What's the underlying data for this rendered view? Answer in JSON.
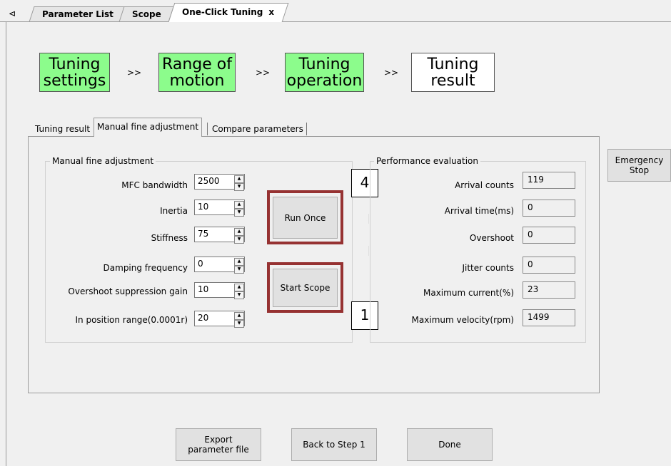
{
  "doc_tabs": {
    "scroll_icon": "⊲",
    "items": [
      "Parameter List",
      "Scope",
      "One-Click Tuning"
    ],
    "close_icon": "x"
  },
  "steps": [
    {
      "label": "Tuning settings",
      "state": "done"
    },
    {
      "label": "Range of motion",
      "state": "done"
    },
    {
      "label": "Tuning operation",
      "state": "done"
    },
    {
      "label": "Tuning result",
      "state": "todo"
    }
  ],
  "step_arrow": ">>",
  "inner_tabs": [
    "Tuning result",
    "Manual fine adjustment",
    "Compare parameters"
  ],
  "manual": {
    "title": "Manual fine adjustment",
    "fields": [
      {
        "label": "MFC bandwidth",
        "value": "2500"
      },
      {
        "label": "Inertia",
        "value": "10"
      },
      {
        "label": "Stiffness",
        "value": "75"
      },
      {
        "label": "Damping frequency",
        "value": "0"
      },
      {
        "label": "Overshoot suppression gain",
        "value": "10"
      },
      {
        "label": "In position range(0.0001r)",
        "value": "20"
      }
    ]
  },
  "buttons": {
    "run_once": "Run Once",
    "start_scope": "Start Scope",
    "emergency_stop": "Emergency Stop",
    "export": "Export parameter file",
    "back": "Back to Step 1",
    "done": "Done"
  },
  "callouts": {
    "run_once": "4",
    "start_scope": "1"
  },
  "performance": {
    "title": "Performance evaluation",
    "items": [
      {
        "label": "Arrival counts",
        "value": "119"
      },
      {
        "label": "Arrival time(ms)",
        "value": "0"
      },
      {
        "label": "Overshoot",
        "value": "0"
      },
      {
        "label": "Jitter counts",
        "value": "0"
      },
      {
        "label": "Maximum current(%)",
        "value": "23"
      },
      {
        "label": "Maximum velocity(rpm)",
        "value": "1499"
      }
    ]
  },
  "colors": {
    "step_done": "#8cfc8c",
    "highlight": "#963232"
  },
  "spin_icons": {
    "up": "▲",
    "down": "▼"
  }
}
